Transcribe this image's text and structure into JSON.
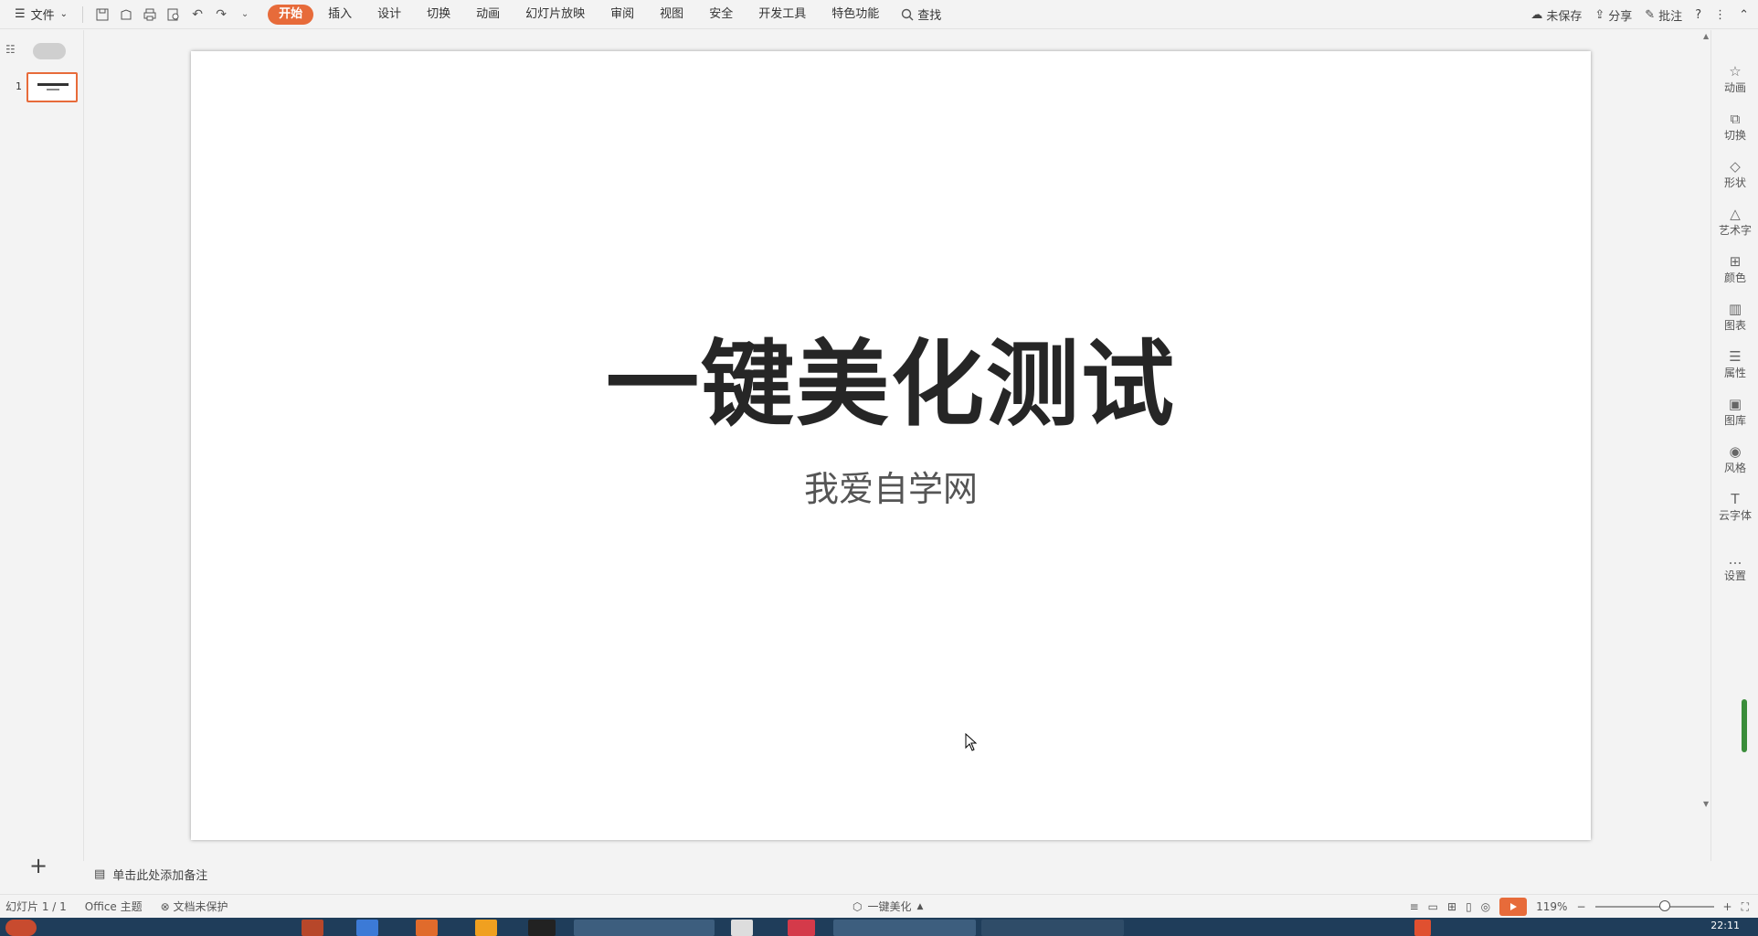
{
  "toolbar": {
    "menu_label": "文件",
    "tabs": [
      "开始",
      "插入",
      "设计",
      "切换",
      "动画",
      "幻灯片放映",
      "审阅",
      "视图",
      "安全",
      "开发工具",
      "特色功能"
    ],
    "active_tab": "开始",
    "find_label": "查找",
    "unsaved_label": "未保存",
    "share_label": "分享",
    "comment_label": "批注"
  },
  "thumbnails": {
    "slide_number": "1"
  },
  "slide": {
    "title": "一键美化测试",
    "subtitle": "我爱自学网"
  },
  "right_panel": {
    "items": [
      "动画",
      "切换",
      "形状",
      "艺术字",
      "颜色",
      "图表",
      "属性",
      "图库",
      "风格",
      "云字体",
      "设置"
    ]
  },
  "notes": {
    "placeholder": "单击此处添加备注"
  },
  "status": {
    "slide_counter": "幻灯片 1 / 1",
    "theme": "Office 主题",
    "protect": "文档未保护",
    "beautify": "一键美化",
    "zoom": "119%"
  },
  "taskbar": {
    "clock": "22:11"
  },
  "colors": {
    "accent": "#e76b3a",
    "taskbar": "#1f3d5a"
  }
}
